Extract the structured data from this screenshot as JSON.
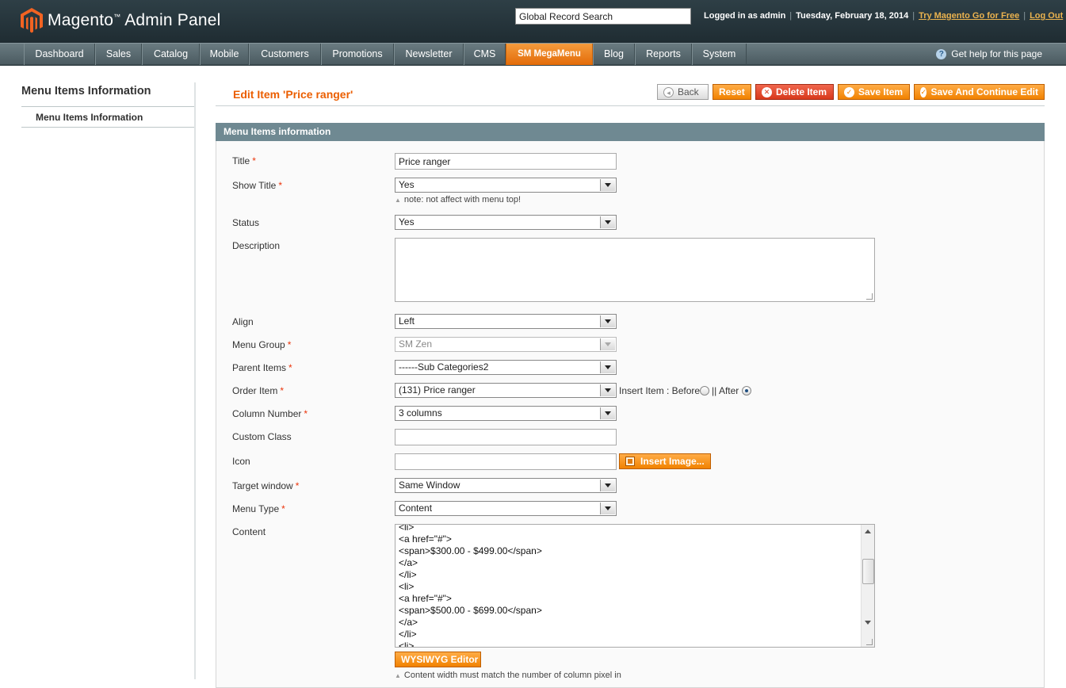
{
  "header": {
    "logo_text": "Magento",
    "logo_tm": "™",
    "logo_suffix": "Admin Panel",
    "search_value": "Global Record Search",
    "logged_in": "Logged in as admin",
    "date": "Tuesday, February 18, 2014",
    "try_link": "Try Magento Go for Free",
    "logout_link": "Log Out"
  },
  "nav": {
    "items": [
      "Dashboard",
      "Sales",
      "Catalog",
      "Mobile",
      "Customers",
      "Promotions",
      "Newsletter",
      "CMS",
      "SM MegaMenu",
      "Blog",
      "Reports",
      "System"
    ],
    "active": "SM MegaMenu",
    "help": "Get help for this page"
  },
  "sidebar": {
    "title": "Menu Items Information",
    "item": "Menu Items Information"
  },
  "page": {
    "title": "Edit Item 'Price ranger'",
    "buttons": {
      "back": "Back",
      "reset": "Reset",
      "delete": "Delete Item",
      "save": "Save Item",
      "save_continue": "Save And Continue Edit"
    }
  },
  "fieldset": {
    "legend": "Menu Items information",
    "fields": {
      "title_label": "Title",
      "title_value": "Price ranger",
      "show_title_label": "Show Title",
      "show_title_value": "Yes",
      "show_title_note": "note: not affect with menu top!",
      "status_label": "Status",
      "status_value": "Yes",
      "description_label": "Description",
      "align_label": "Align",
      "align_value": "Left",
      "menu_group_label": "Menu Group",
      "menu_group_value": "SM Zen",
      "parent_items_label": "Parent Items",
      "parent_items_value": "------Sub Categories2",
      "order_item_label": "Order Item",
      "order_item_value": "(131) Price ranger",
      "insert_before": "Insert Item : Before",
      "insert_after": "|| After",
      "column_number_label": "Column Number",
      "column_number_value": "3 columns",
      "custom_class_label": "Custom Class",
      "icon_label": "Icon",
      "insert_image": "Insert Image...",
      "target_window_label": "Target window",
      "target_window_value": "Same Window",
      "menu_type_label": "Menu Type",
      "menu_type_value": "Content",
      "content_label": "Content",
      "content_text": "<li>\n<a href=\"#\">\n<span>$300.00 - $499.00</span>\n</a>\n</li>\n<li>\n<a href=\"#\">\n<span>$500.00 - $699.00</span>\n</a>\n</li>\n<li>",
      "wysiwyg": "WYSIWYG Editor",
      "content_note": "Content width must match the number of column pixel in"
    },
    "required_mark": "*"
  },
  "colors": {
    "accent": "#eb5e00",
    "nav_bg": "#55656b",
    "fieldset_head": "#6f8992"
  }
}
